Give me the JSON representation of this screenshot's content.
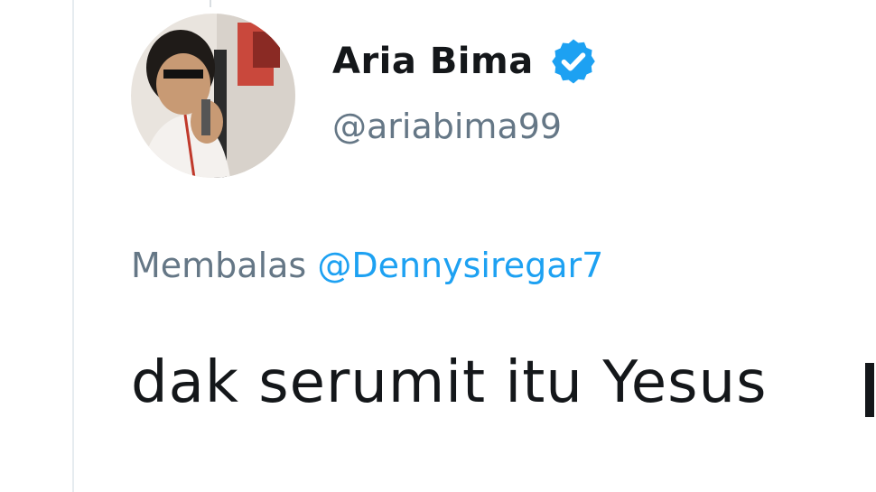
{
  "tweet": {
    "author": {
      "display_name": "Aria Bima",
      "handle": "@ariabima99",
      "verified": true,
      "avatar_icon": "profile-photo"
    },
    "reply_context": {
      "prefix": "Membalas",
      "mention": "@Dennysiregar7"
    },
    "text": "dak serumit itu Yesus"
  },
  "colors": {
    "name": "#14171a",
    "secondary": "#657786",
    "link": "#1da1f2",
    "verified_badge": "#1da1f2",
    "divider": "#e6ecf0"
  }
}
